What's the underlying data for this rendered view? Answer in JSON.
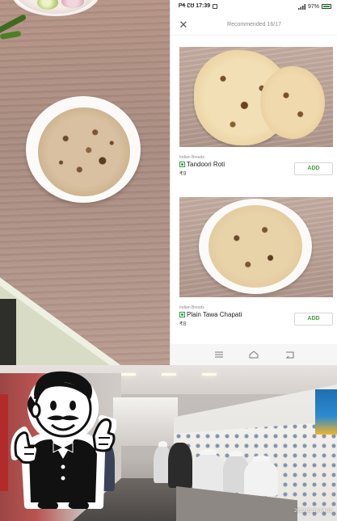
{
  "status_bar": {
    "left_text": "ᏢᏎ ᏝᏌ 17:39",
    "right_text": "97%"
  },
  "header": {
    "title": "Recommended 16/17"
  },
  "items": [
    {
      "category": "Indian Breads",
      "name": "Tandoori Roti",
      "price": "₹9",
      "add_label": "ADD"
    },
    {
      "category": "Indian Breads",
      "name": "Plain Tawa Chapati",
      "price": "₹8",
      "add_label": "ADD"
    }
  ],
  "photo_timestamp": "2019.05.16 04:03",
  "colors": {
    "add_text": "#48a23f",
    "veg_green": "#2f9e44"
  },
  "icons": {
    "close": "close-icon",
    "veg": "veg-indicator-icon",
    "nav_menu": "menu-icon",
    "nav_home": "home-icon",
    "nav_back": "back-icon",
    "logo": "waiter-logo-icon"
  }
}
